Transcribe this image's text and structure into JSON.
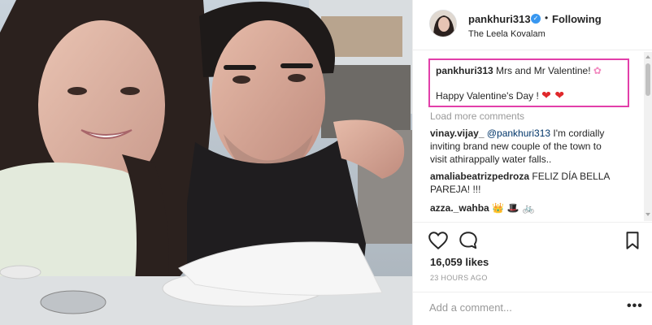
{
  "header": {
    "username": "pankhuri313",
    "verified_glyph": "✓",
    "separator": "•",
    "follow_label": "Following",
    "location": "The Leela Kovalam"
  },
  "caption": {
    "username": "pankhuri313",
    "line1": "Mrs and Mr Valentine!",
    "line1_emoji": "✿",
    "line2": "Happy Valentine's Day !",
    "line2_emoji": "❤ ❤"
  },
  "load_more_label": "Load more comments",
  "comments": [
    {
      "user": "vinay.vijay_",
      "mention": "@pankhuri313",
      "text": "I'm cordially",
      "text2": "inviting brand new couple of the town to",
      "text3": "visit athirappally water falls.."
    },
    {
      "user": "amaliabeatrizpedroza",
      "text": "FELIZ DÍA BELLA",
      "text2": "PAREJA! !!!"
    },
    {
      "user": "azza._wahba",
      "text": "👑 🎩 🚲"
    }
  ],
  "actions": {
    "like_icon": "heart-outline-icon",
    "comment_icon": "speech-bubble-icon",
    "save_icon": "bookmark-icon",
    "likes": "16,059 likes",
    "time_ago": "23 HOURS AGO"
  },
  "add_comment": {
    "placeholder": "Add a comment...",
    "more_glyph": "•••"
  },
  "colors": {
    "highlight_border": "#e23faa",
    "verified": "#3897f0",
    "mention": "#003569",
    "heart": "#e0282b"
  }
}
